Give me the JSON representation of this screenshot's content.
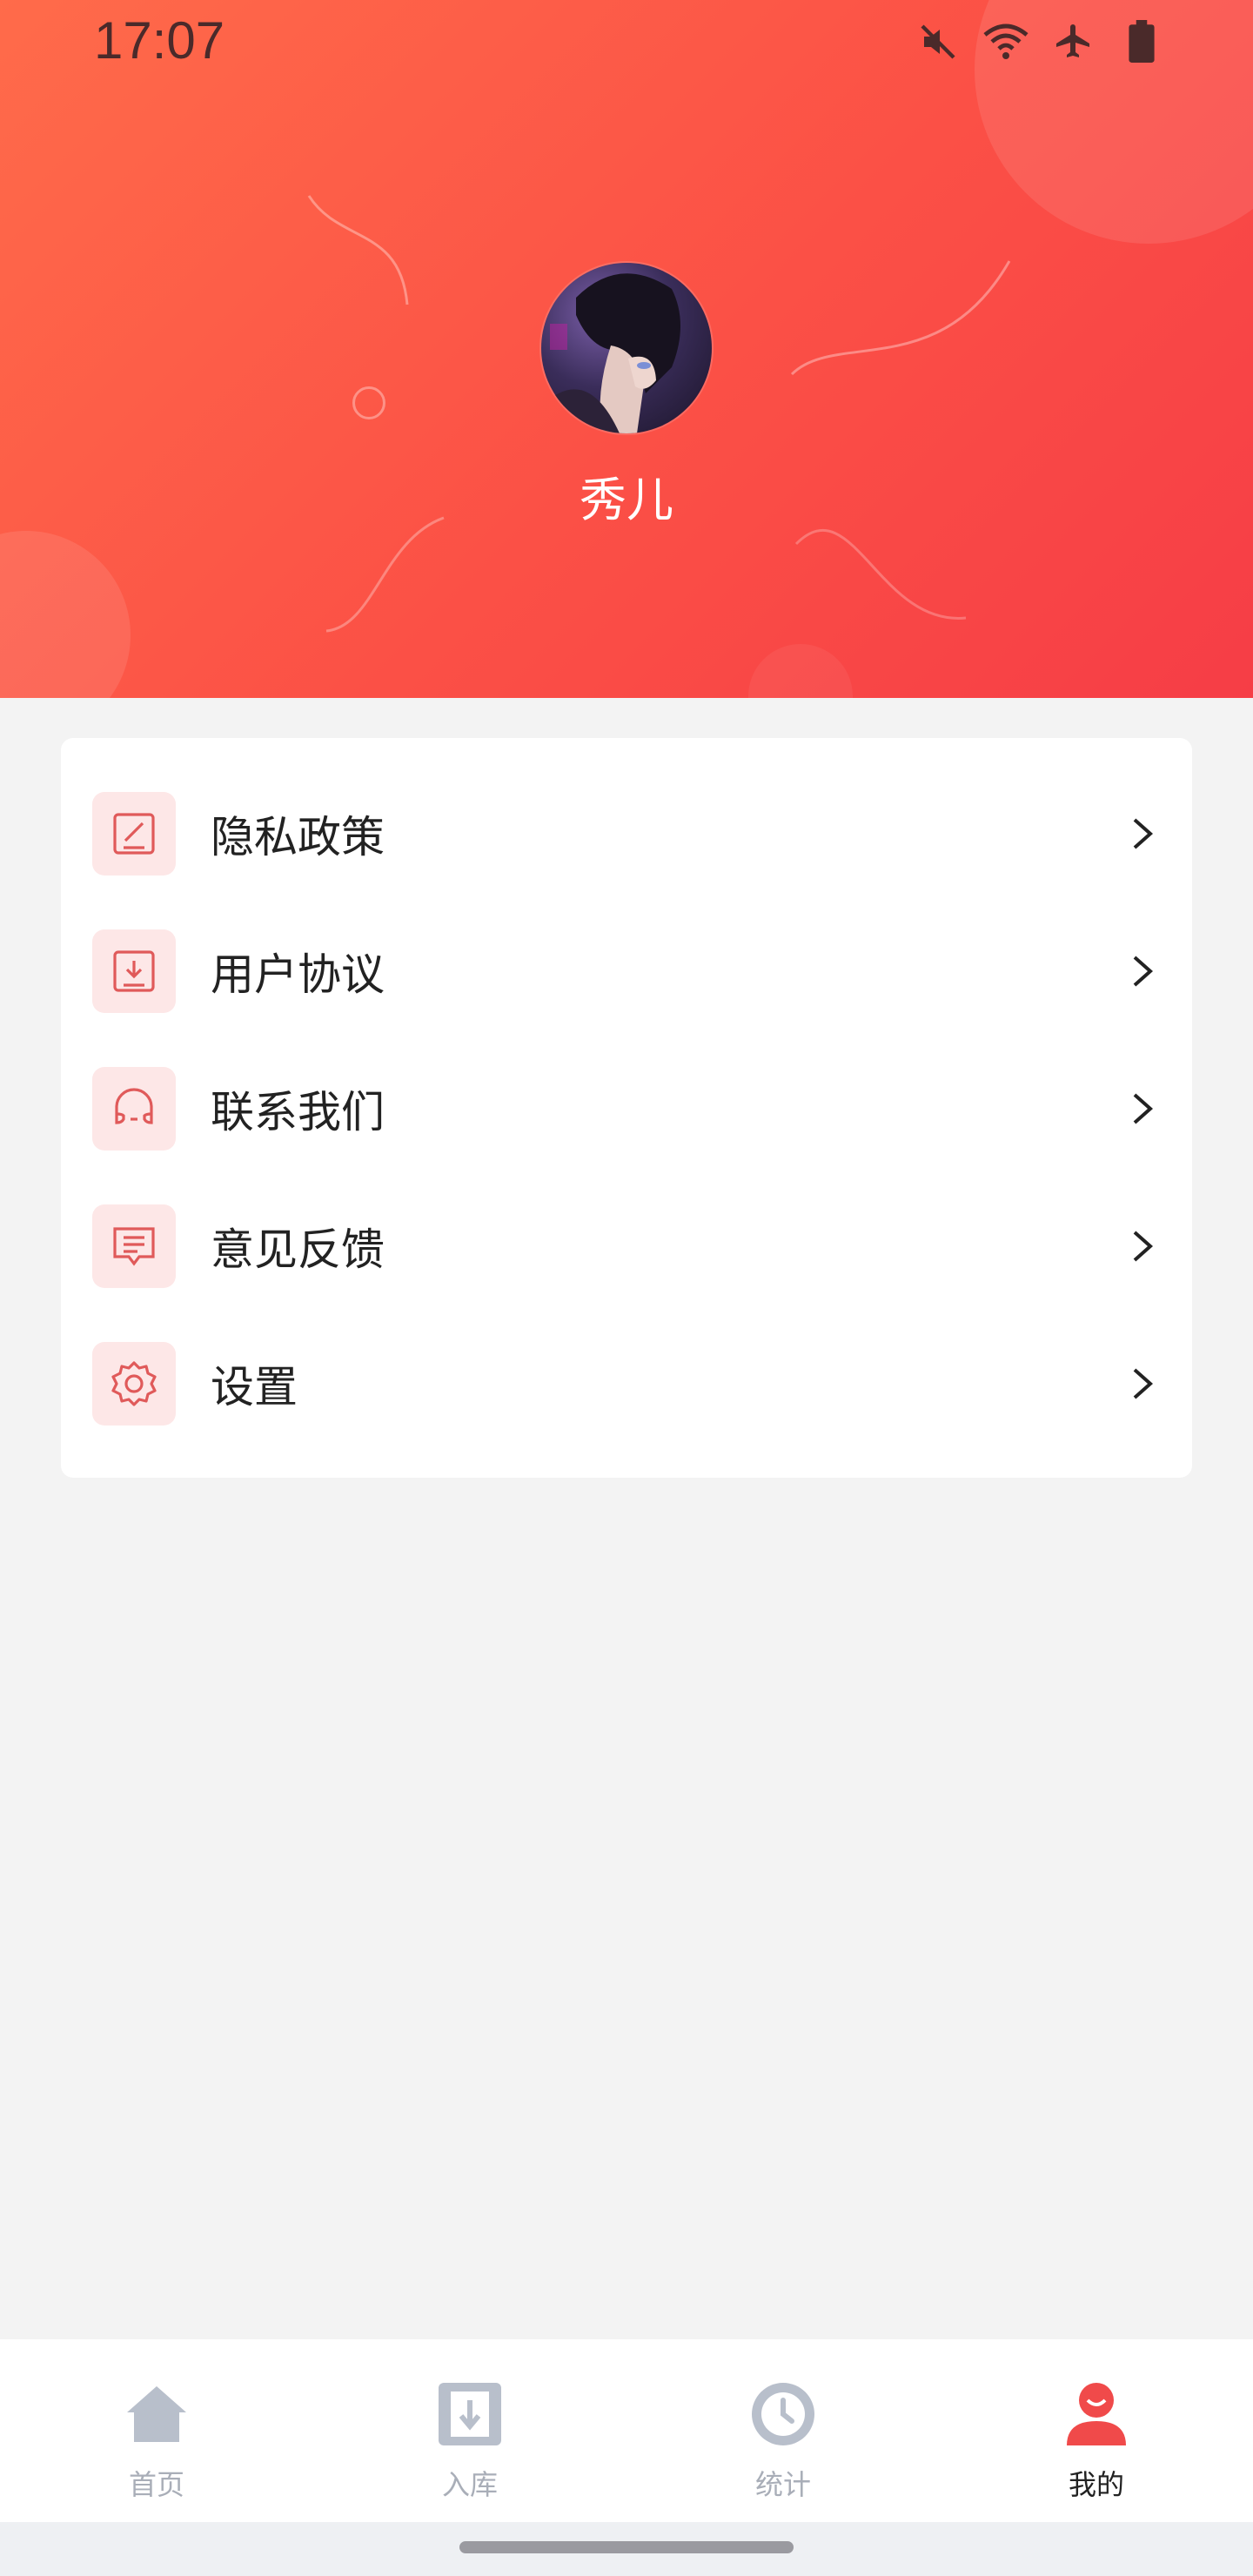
{
  "status_bar": {
    "time": "17:07",
    "icons": [
      "mute-icon",
      "wifi-icon",
      "airplane-icon",
      "battery-icon"
    ]
  },
  "profile": {
    "username": "秀儿"
  },
  "menu": {
    "items": [
      {
        "label": "隐私政策",
        "icon": "edit-document-icon"
      },
      {
        "label": "用户协议",
        "icon": "download-document-icon"
      },
      {
        "label": "联系我们",
        "icon": "headset-icon"
      },
      {
        "label": "意见反馈",
        "icon": "feedback-message-icon"
      },
      {
        "label": "设置",
        "icon": "gear-icon"
      }
    ]
  },
  "bottom_nav": {
    "items": [
      {
        "label": "首页",
        "icon": "home-icon",
        "active": false
      },
      {
        "label": "入库",
        "icon": "inbound-icon",
        "active": false
      },
      {
        "label": "统计",
        "icon": "clock-icon",
        "active": false
      },
      {
        "label": "我的",
        "icon": "user-icon",
        "active": true
      }
    ]
  },
  "colors": {
    "header_gradient_start": "#ff6b4a",
    "header_gradient_end": "#f63d46",
    "accent": "#f05050",
    "icon_bg": "#fde7e7",
    "nav_inactive": "#a9aeb8",
    "page_bg": "#f3f3f3"
  }
}
